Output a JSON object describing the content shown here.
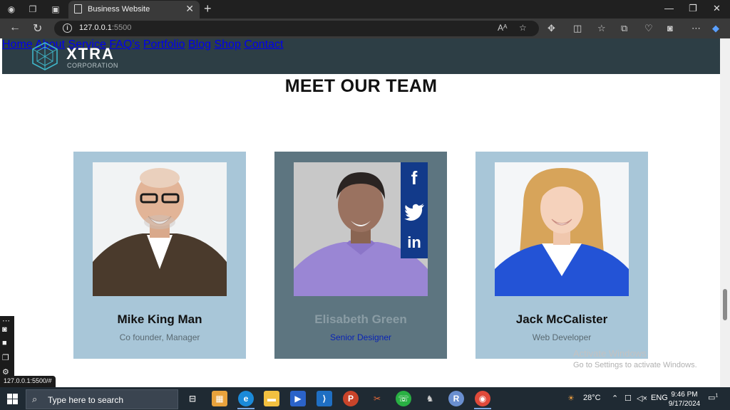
{
  "browser": {
    "tab_title": "Business Website",
    "url_host": "127.0.0.1",
    "url_port": ":5500"
  },
  "site": {
    "logo_text": "XTRA",
    "logo_sub": "CORPORATION",
    "menu": [
      "Home",
      "About",
      "Service",
      "FAQ's",
      "Portfolio",
      "Blog",
      "Shop",
      "Contact"
    ],
    "section_title": "MEET OUR TEAM",
    "team": [
      {
        "name": "Mike King Man",
        "role": "Co founder, Manager"
      },
      {
        "name": "Elisabeth Green",
        "role": "Senior Designer"
      },
      {
        "name": "Jack McCalister",
        "role": "Web Developer"
      }
    ],
    "social": [
      "f",
      "t",
      "in"
    ]
  },
  "windows": {
    "activate_title": "Activate Windows",
    "activate_sub": "Go to Settings to activate Windows."
  },
  "status_url": "127.0.0.1:5500/#",
  "taskbar": {
    "search_placeholder": "Type here to search",
    "temperature": "28°C",
    "lang": "ENG",
    "time": "9:46 PM",
    "date": "9/17/2024",
    "notif_count": "1"
  },
  "colors": {
    "header_bg": "#2d3e45",
    "card_bg": "#a8c6d8",
    "card_active_bg": "#5d7580",
    "social_bg": "#123a8a",
    "role_active": "#0a24b5"
  }
}
